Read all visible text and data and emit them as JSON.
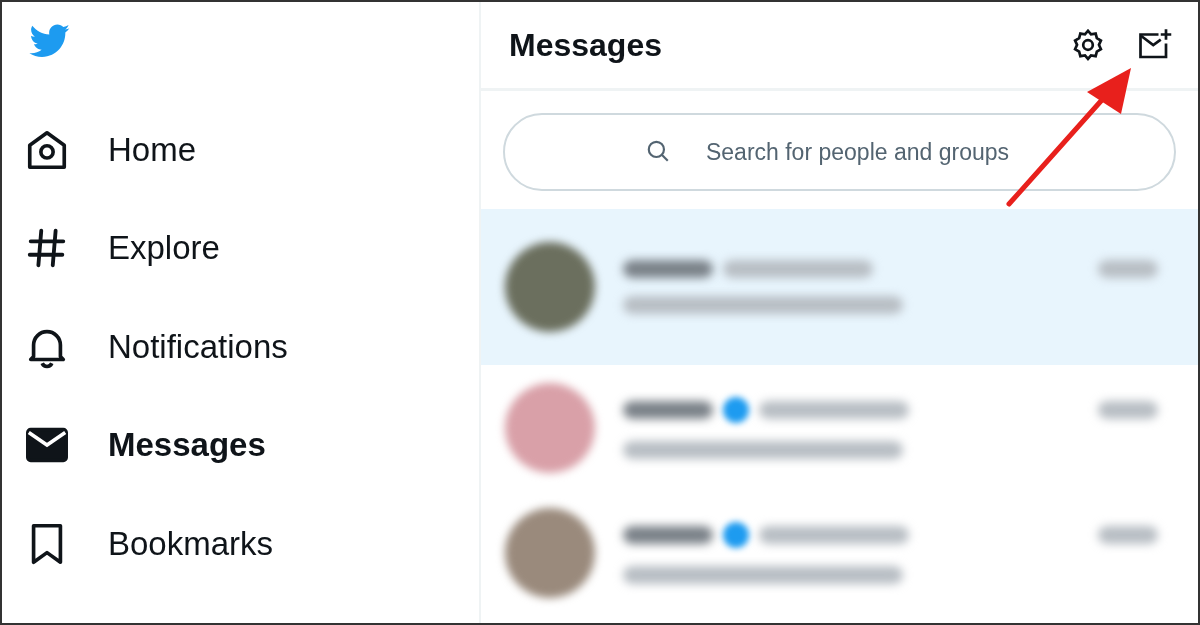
{
  "nav": [
    {
      "label": "Home",
      "selected": false
    },
    {
      "label": "Explore",
      "selected": false
    },
    {
      "label": "Notifications",
      "selected": false
    },
    {
      "label": "Messages",
      "selected": true
    },
    {
      "label": "Bookmarks",
      "selected": false
    }
  ],
  "messages": {
    "title": "Messages",
    "search": {
      "placeholder": "Search for people and groups"
    },
    "conversations": [
      {
        "selected": true,
        "verified": false
      },
      {
        "selected": false,
        "verified": true
      },
      {
        "selected": false,
        "verified": true
      }
    ]
  }
}
